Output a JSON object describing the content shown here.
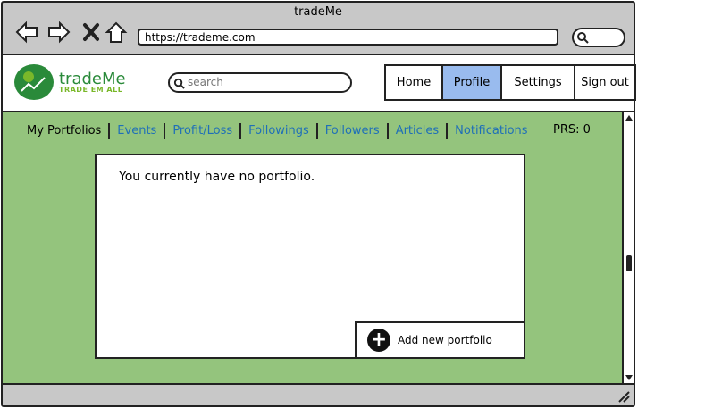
{
  "browser": {
    "title": "tradeMe",
    "url": "https://trademe.com"
  },
  "header": {
    "brand": "tradeMe",
    "tagline": "TRADE EM ALL",
    "search_placeholder": "search",
    "nav": [
      {
        "label": "Home",
        "active": false
      },
      {
        "label": "Profile",
        "active": true
      },
      {
        "label": "Settings",
        "active": false
      },
      {
        "label": "Sign out",
        "active": false
      }
    ]
  },
  "tabs": [
    {
      "label": "My Portfolios"
    },
    {
      "label": "Events"
    },
    {
      "label": "Profit/Loss"
    },
    {
      "label": "Followings"
    },
    {
      "label": "Followers"
    },
    {
      "label": "Articles"
    },
    {
      "label": "Notifications"
    }
  ],
  "prs": "PRS: 0",
  "panel": {
    "empty_message": "You currently have no portfolio.",
    "add_label": "Add new portfolio"
  },
  "colors": {
    "content_bg": "#94c47d",
    "active_nav": "#99bbee",
    "tab_link": "#1f6fb8",
    "brand_green": "#2a8a3a"
  }
}
